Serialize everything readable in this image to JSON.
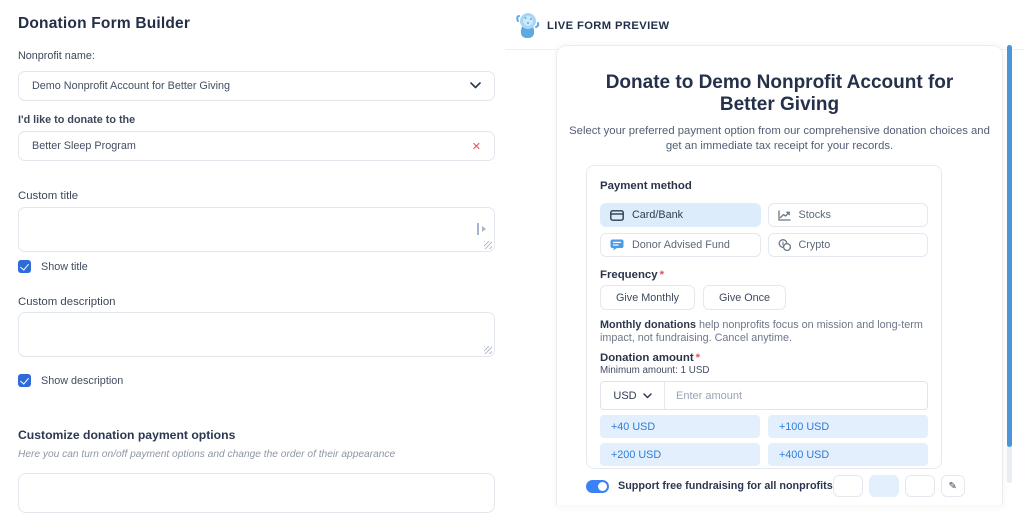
{
  "builder": {
    "title": "Donation Form Builder",
    "nonprofit_label": "Nonprofit name:",
    "nonprofit_value": "Demo Nonprofit Account for Better Giving",
    "designation_label": "I'd like to donate to the",
    "designation_value": "Better Sleep Program",
    "custom_title_label": "Custom title",
    "show_title_label": "Show title",
    "custom_description_label": "Custom description",
    "show_description_label": "Show description",
    "customize_heading": "Customize donation payment options",
    "customize_hint": "Here you can turn on/off payment options and change the order of their appearance"
  },
  "preview": {
    "header": "LIVE FORM PREVIEW",
    "form": {
      "title": "Donate to Demo Nonprofit Account for Better Giving",
      "subtitle": "Select your preferred payment option from our comprehensive donation choices and get an immediate tax receipt for your records.",
      "payment_method_label": "Payment method",
      "methods": [
        {
          "label": "Card/Bank",
          "icon": "credit-card-icon",
          "selected": true
        },
        {
          "label": "Stocks",
          "icon": "stock-chart-icon",
          "selected": false
        },
        {
          "label": "Donor Advised Fund",
          "icon": "daf-icon",
          "selected": false
        },
        {
          "label": "Crypto",
          "icon": "crypto-coins-icon",
          "selected": false
        }
      ],
      "frequency_label": "Frequency",
      "required_marker": "*",
      "frequency_options": [
        "Give Monthly",
        "Give Once"
      ],
      "monthly_note_bold": "Monthly donations",
      "monthly_note_rest": " help nonprofits focus on mission and long-term impact, not fundraising. Cancel anytime.",
      "amount_label": "Donation amount",
      "minimum_note": "Minimum amount: 1 USD",
      "currency": "USD",
      "amount_placeholder": "Enter amount",
      "preset_amounts": [
        "+40 USD",
        "+100 USD",
        "+200 USD",
        "+400 USD"
      ],
      "footer_toggle_label": "Support free fundraising for all nonprofits"
    }
  },
  "icons": {
    "close": "✕",
    "pencil": "✎"
  },
  "colors": {
    "accent_blue": "#2e7cd6",
    "light_blue_bg": "#e3effc",
    "selected_method_bg": "#ddecfa",
    "checkbox_blue": "#2d6bdb",
    "toggle_blue": "#3b82f6",
    "error_red": "#e25563",
    "scrollbar_blue": "#4a96d8",
    "heading_dark": "#222f46"
  }
}
